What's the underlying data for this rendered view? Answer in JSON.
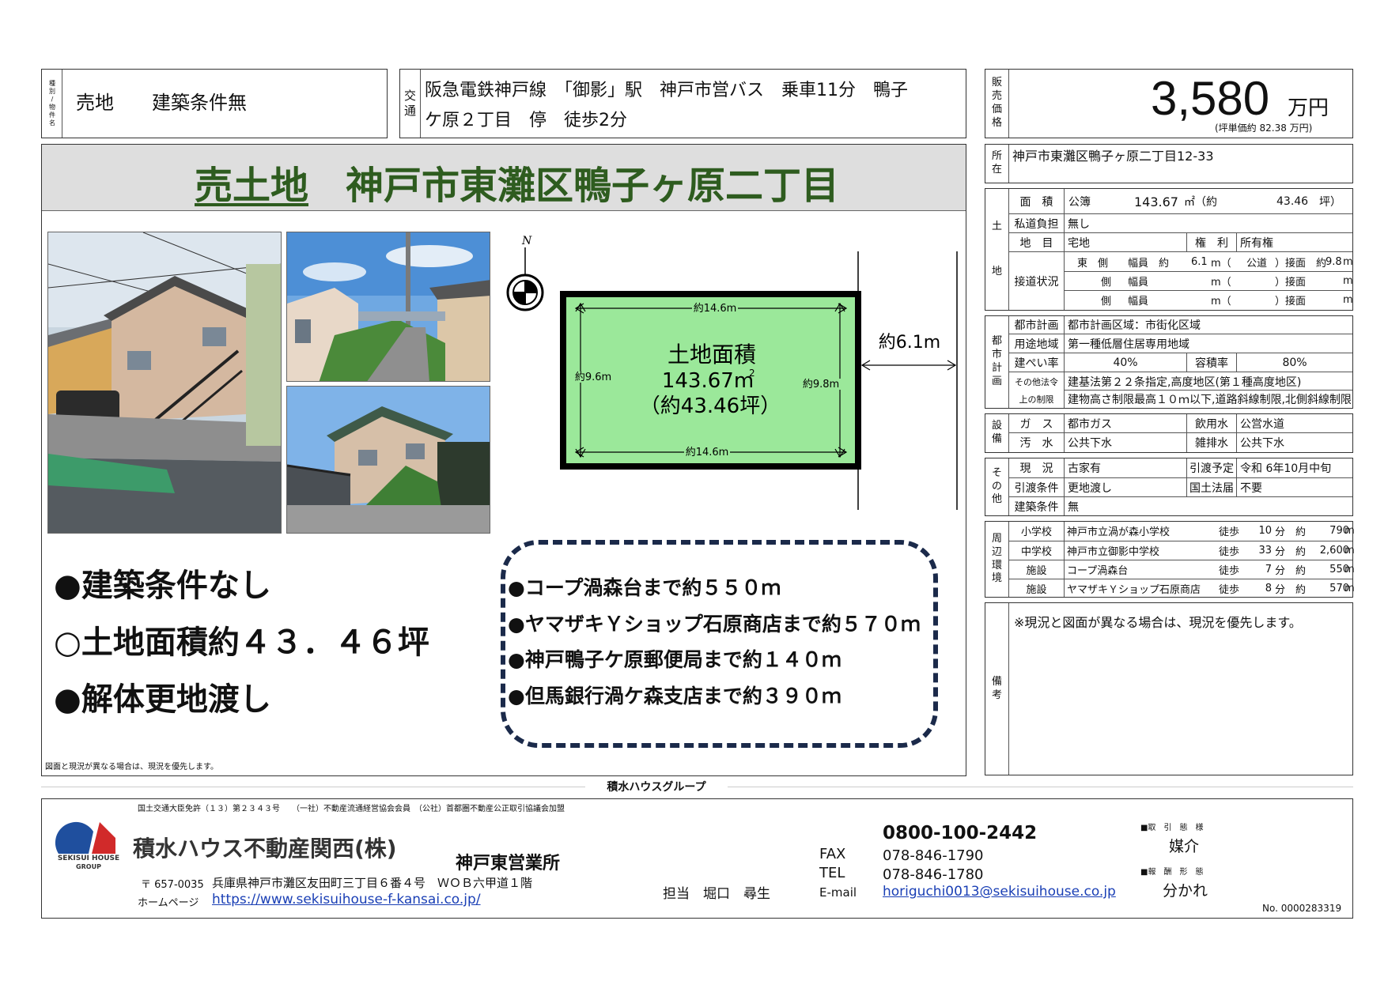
{
  "header": {
    "category_label": [
      "種",
      "別",
      "/",
      "物",
      "件",
      "名"
    ],
    "category_value": "売地　　建築条件無",
    "transport_label": [
      "交",
      "通"
    ],
    "transport_line1": "阪急電鉄神戸線　「御影」駅　神戸市営バス　乗車11分　鴨子",
    "transport_line2": "ケ原２丁目　停　徒歩2分",
    "price_label": [
      "販",
      "売",
      "価",
      "格"
    ],
    "price_value": "3,580",
    "price_unit": "万円",
    "price_note": "(坪単価約 82.38 万円)"
  },
  "banner": {
    "title_a": "売土地",
    "title_b": "神戸市東灘区鴨子ヶ原二丁目"
  },
  "location": {
    "label": [
      "所",
      "在"
    ],
    "value": "神戸市東灘区鴨子ヶ原二丁目12-33"
  },
  "land": {
    "label": [
      "土",
      "地"
    ],
    "area_label": "面　積",
    "area_kind": "公簿",
    "area_sqm": "143.67",
    "area_unit": "㎡（約",
    "area_tsubo": "43.46",
    "area_tsubo_unit": "坪）",
    "private_road_label": "私道負担",
    "private_road_value": "無し",
    "chimoku_label": "地　目",
    "chimoku_value": "宅地",
    "rights_label": "権　利",
    "rights_value": "所有権",
    "road_label": "接道状況",
    "road1": {
      "dir": "東　側",
      "width_label": "幅員　約",
      "width": "6.1",
      "unit": "m（",
      "kind": "公道",
      "close": "）接面　約",
      "frontage": "9.8",
      "m": "m"
    },
    "road2": {
      "dir": "側",
      "width_label": "幅員",
      "unit": "m（",
      "close": "）接面",
      "m": "m"
    },
    "road3": {
      "dir": "側",
      "width_label": "幅員",
      "unit": "m（",
      "close": "）接面",
      "m": "m"
    }
  },
  "city": {
    "label": [
      "都",
      "市",
      "計",
      "画"
    ],
    "plan_label": "都市計画",
    "plan_value": "都市計画区域：市街化区域",
    "use_label": "用途地域",
    "use_value": "第一種低層住居専用地域",
    "bcr_label": "建ぺい率",
    "bcr_value": "40%",
    "far_label": "容積率",
    "far_value": "80%",
    "other_label1": "その他法令",
    "other_label2": "上の制限",
    "other_value1": "建基法第２２条指定,高度地区(第１種高度地区)",
    "other_value2": "建物高さ制限最高１０ｍ以下,道路斜線制限,北側斜線制限"
  },
  "facility": {
    "label": [
      "設",
      "備"
    ],
    "gas_label": "ガ　ス",
    "gas_value": "都市ガス",
    "water_label": "飲用水",
    "water_value": "公営水道",
    "sewage_label": "汚　水",
    "sewage_value": "公共下水",
    "drain_label": "雑排水",
    "drain_value": "公共下水"
  },
  "other": {
    "label": [
      "そ",
      "の",
      "他"
    ],
    "status_label": "現　況",
    "status_value": "古家有",
    "handover_date_label": "引渡予定",
    "handover_date_value": "令和 6年10月中旬",
    "handover_cond_label": "引渡条件",
    "handover_cond_value": "更地渡し",
    "land_act_label": "国土法届",
    "land_act_value": "不要",
    "build_cond_label": "建築条件",
    "build_cond_value": "無"
  },
  "surroundings": {
    "label": [
      "周",
      "辺",
      "環",
      "境"
    ],
    "rows": [
      {
        "kind": "小学校",
        "name": "神戸市立渦が森小学校",
        "walk": "徒歩",
        "min": "10",
        "fun": "分　約",
        "dist": "790",
        "m": "m"
      },
      {
        "kind": "中学校",
        "name": "神戸市立御影中学校",
        "walk": "徒歩",
        "min": "33",
        "fun": "分　約",
        "dist": "2,600",
        "m": "m"
      },
      {
        "kind": "施設",
        "name": "コープ渦森台",
        "walk": "徒歩",
        "min": "7",
        "fun": "分　約",
        "dist": "550",
        "m": "m"
      },
      {
        "kind": "施設",
        "name": "ヤマザキＹショップ石原商店",
        "walk": "徒歩",
        "min": "8",
        "fun": "分　約",
        "dist": "570",
        "m": "m"
      }
    ]
  },
  "remarks": {
    "label": [
      "備",
      "考"
    ],
    "text": "※現況と図面が異なる場合は、現況を優先します。"
  },
  "plot": {
    "compass": "N",
    "area_title": "土地面積",
    "area_sqm": "143.67m",
    "area_sup": "2",
    "area_tsubo": "（約43.46坪）",
    "top": "約14.6m",
    "bottom": "約14.6m",
    "left": "約9.6m",
    "right": "約9.8m",
    "road": "約6.1m",
    "fill": "#9be89a"
  },
  "features": [
    "●建築条件なし",
    "○土地面積約４３．４６坪",
    "●解体更地渡し"
  ],
  "nearby": [
    "●コープ渦森台まで約５５０ｍ",
    "●ヤマザキＹショップ石原商店まで約５７０ｍ",
    "●神戸鴨子ケ原郵便局まで約１４０ｍ",
    "●但馬銀行渦ケ森支店まで約３９０ｍ"
  ],
  "small_note": "図面と現況が異なる場合は、現況を優先します。",
  "group_label": "積水ハウスグループ",
  "footer": {
    "license": "国土交通大臣免許（１３）第２３４３号　　（一社）不動産流通経営協会会員　（公社）首都圏不動産公正取引協議会加盟",
    "logo_text": "SEKISUI HOUSE",
    "logo_sub": "GROUP",
    "company": "積水ハウス不動産関西(株)",
    "branch": "神戸東営業所",
    "postal": "〒 657-0035",
    "address": "兵庫県神戸市灘区友田町三丁目６番４号　ＷＯＢ六甲道１階",
    "homepage_label": "ホームページ",
    "homepage": "https://www.sekisuihouse-f-kansai.co.jp/",
    "staff": "担当　堀口　尋生",
    "freedial": "0800-100-2442",
    "fax_label": "FAX",
    "fax": "078-846-1790",
    "tel_label": "TEL",
    "tel": "078-846-1780",
    "email_label": "E-mail",
    "email": "horiguchi0013@sekisuihouse.co.jp",
    "deal_label": "■取　引　態　様",
    "deal_value": "媒介",
    "fee_label": "■報　酬　形　態",
    "fee_value": "分かれ",
    "doc_no": "No.  0000283319"
  }
}
